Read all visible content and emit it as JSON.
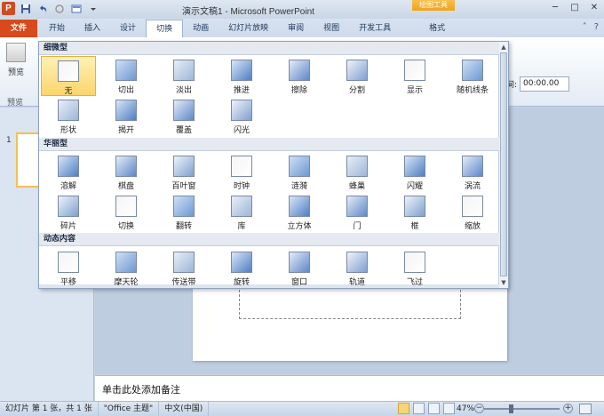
{
  "window": {
    "title": "演示文稿1  -  Microsoft PowerPoint",
    "context_tab_group": "绘图工具"
  },
  "qat": {
    "app_icon": "P",
    "icons": [
      "save-icon",
      "undo-icon",
      "redo-icon",
      "new-icon",
      "customize-icon"
    ]
  },
  "ribbon": {
    "tabs": [
      {
        "label": "文件",
        "type": "file"
      },
      {
        "label": "开始"
      },
      {
        "label": "插入"
      },
      {
        "label": "设计"
      },
      {
        "label": "切换",
        "active": true
      },
      {
        "label": "动画"
      },
      {
        "label": "幻灯片放映"
      },
      {
        "label": "审阅"
      },
      {
        "label": "视图"
      },
      {
        "label": "开发工具"
      },
      {
        "label": "格式",
        "type": "context"
      }
    ],
    "preview_label": "预览",
    "preview_group_label": "预览",
    "timing_label": "间:",
    "timing_value": "00:00.00"
  },
  "gallery": {
    "sections": [
      {
        "title": "细微型",
        "items": [
          "无",
          "切出",
          "淡出",
          "推进",
          "擦除",
          "分割",
          "显示",
          "随机线条",
          "形状",
          "揭开",
          "覆盖",
          "闪光"
        ]
      },
      {
        "title": "华丽型",
        "items": [
          "溶解",
          "棋盘",
          "百叶窗",
          "时钟",
          "涟漪",
          "蜂巢",
          "闪耀",
          "涡流",
          "碎片",
          "切换",
          "翻转",
          "库",
          "立方体",
          "门",
          "框",
          "缩放"
        ]
      },
      {
        "title": "动态内容",
        "items": [
          "平移",
          "摩天轮",
          "传送带",
          "旋转",
          "窗口",
          "轨道",
          "飞过"
        ]
      }
    ],
    "selected_item": "无"
  },
  "slides_pane": {
    "slide_number": "1"
  },
  "notes": {
    "placeholder": "单击此处添加备注"
  },
  "status": {
    "slide_info": "幻灯片 第 1 张，共 1 张",
    "theme": "\"Office 主题\"",
    "language": "中文(中国)",
    "zoom": "47%",
    "zoom_level": 0.47
  },
  "colors": {
    "file_tab": "#d74a1c",
    "context_tab": "#f0a118",
    "selected_item": "#fbd56a"
  }
}
